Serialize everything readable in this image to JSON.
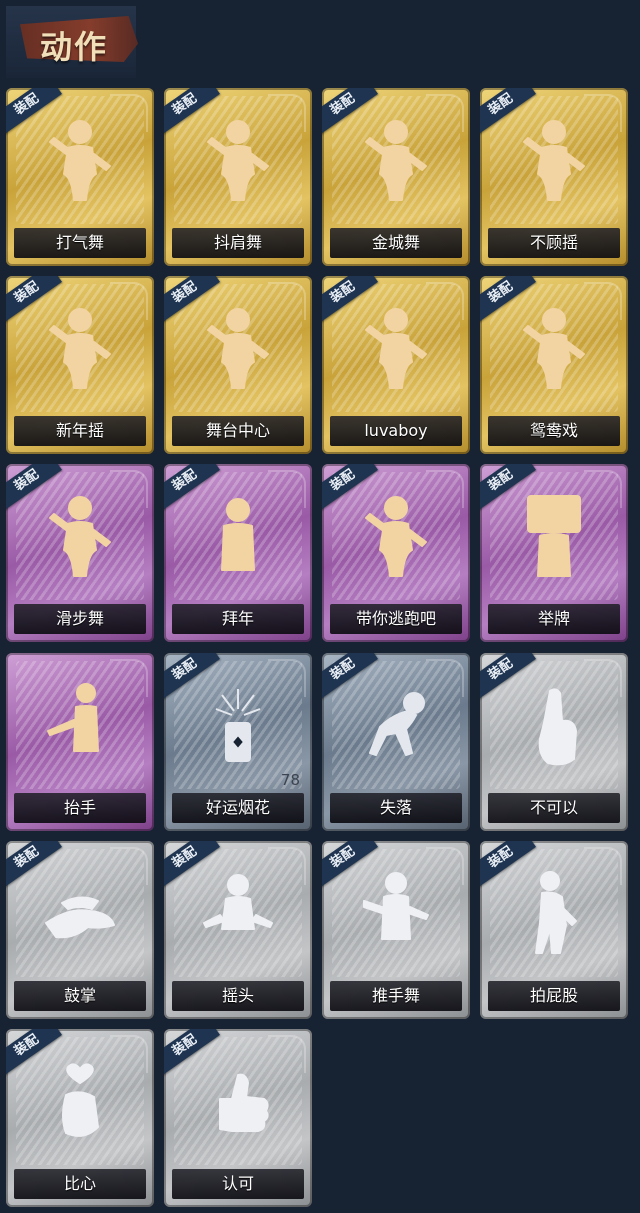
{
  "header": {
    "title": "动作"
  },
  "equip_tag": "装配",
  "cards": [
    {
      "label": "打气舞",
      "rarity": "gold",
      "equipped": true,
      "icon": "dance-figure-icon"
    },
    {
      "label": "抖肩舞",
      "rarity": "gold",
      "equipped": true,
      "icon": "dance-figure-icon"
    },
    {
      "label": "金城舞",
      "rarity": "gold",
      "equipped": true,
      "icon": "dance-figure-icon"
    },
    {
      "label": "不顾摇",
      "rarity": "gold",
      "equipped": true,
      "icon": "dance-figure-icon"
    },
    {
      "label": "新年摇",
      "rarity": "gold",
      "equipped": true,
      "icon": "dance-figure-icon"
    },
    {
      "label": "舞台中心",
      "rarity": "gold",
      "equipped": true,
      "icon": "dance-figure-icon"
    },
    {
      "label": "luvaboy",
      "rarity": "gold",
      "equipped": true,
      "icon": "dance-figure-icon"
    },
    {
      "label": "鸳鸯戏",
      "rarity": "gold",
      "equipped": true,
      "icon": "dance-figure-icon"
    },
    {
      "label": "滑步舞",
      "rarity": "purple",
      "equipped": true,
      "icon": "dance-figure-icon"
    },
    {
      "label": "拜年",
      "rarity": "purple",
      "equipped": true,
      "icon": "bow-figure-icon"
    },
    {
      "label": "带你逃跑吧",
      "rarity": "purple",
      "equipped": true,
      "icon": "dance-figure-icon"
    },
    {
      "label": "举牌",
      "rarity": "purple",
      "equipped": true,
      "icon": "sign-figure-icon"
    },
    {
      "label": "抬手",
      "rarity": "purple",
      "equipped": false,
      "icon": "raise-hand-figure-icon"
    },
    {
      "label": "好运烟花",
      "rarity": "blue",
      "equipped": true,
      "icon": "firework-icon",
      "count": "78"
    },
    {
      "label": "失落",
      "rarity": "blue",
      "equipped": true,
      "icon": "crawl-figure-icon"
    },
    {
      "label": "不可以",
      "rarity": "gray",
      "equipped": true,
      "icon": "finger-wag-icon"
    },
    {
      "label": "鼓掌",
      "rarity": "gray",
      "equipped": true,
      "icon": "clap-hands-icon"
    },
    {
      "label": "摇头",
      "rarity": "gray",
      "equipped": true,
      "icon": "shake-head-figure-icon"
    },
    {
      "label": "推手舞",
      "rarity": "gray",
      "equipped": true,
      "icon": "push-hands-figure-icon"
    },
    {
      "label": "拍屁股",
      "rarity": "gray",
      "equipped": true,
      "icon": "pat-figure-icon"
    },
    {
      "label": "比心",
      "rarity": "gray",
      "equipped": true,
      "icon": "finger-heart-icon"
    },
    {
      "label": "认可",
      "rarity": "gray",
      "equipped": true,
      "icon": "thumbs-up-icon"
    }
  ]
}
